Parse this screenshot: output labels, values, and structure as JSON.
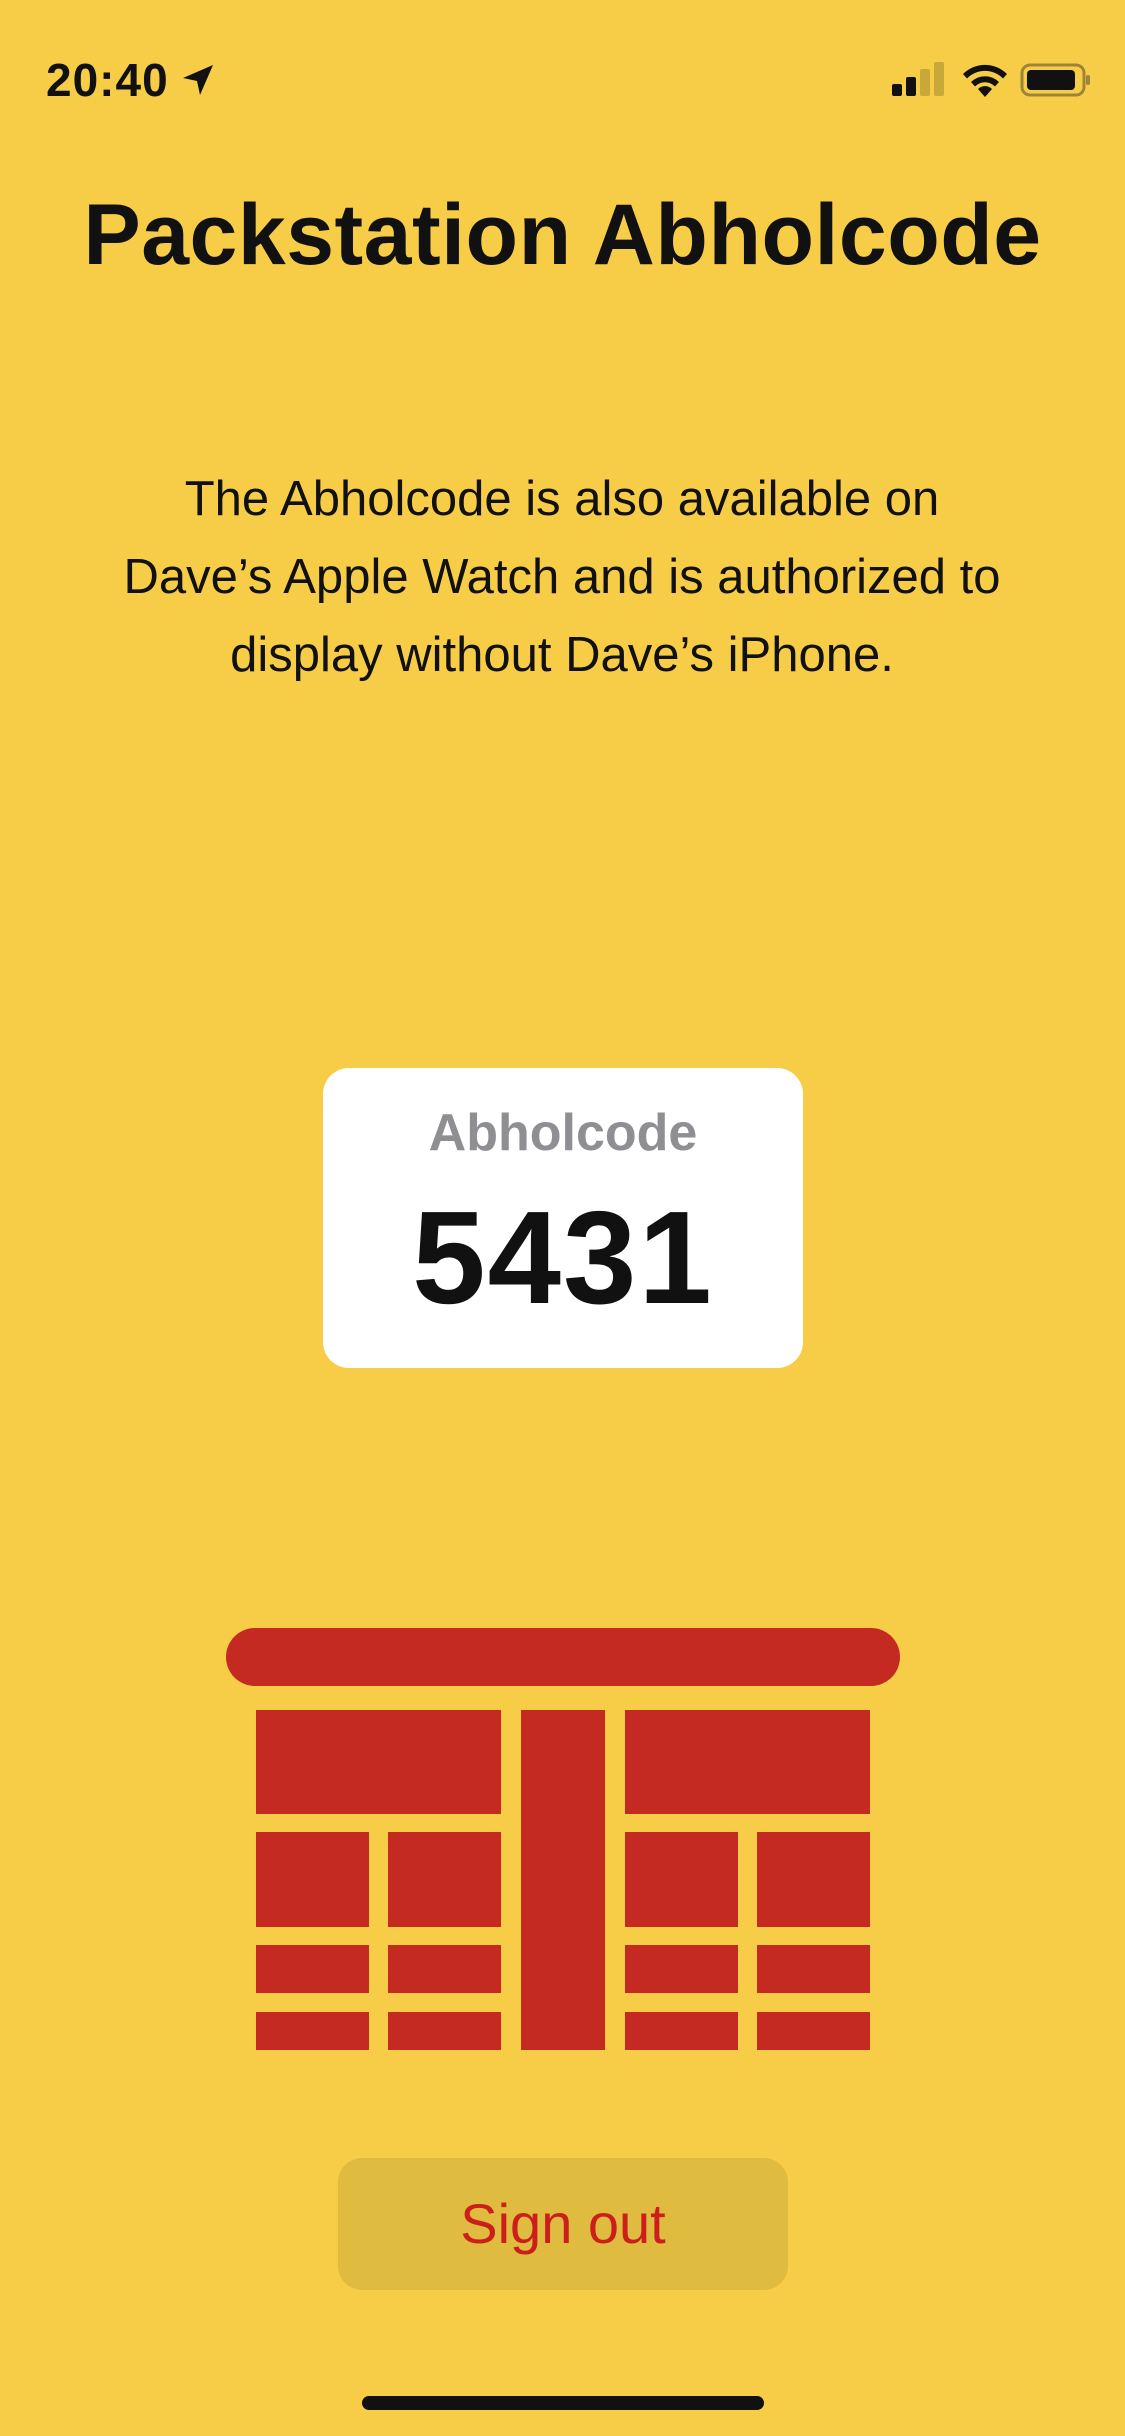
{
  "status_bar": {
    "time": "20:40",
    "icons": [
      "location-arrow-icon",
      "cellular-signal-icon",
      "wifi-icon",
      "battery-icon"
    ]
  },
  "page": {
    "title": "Packstation Abholcode",
    "description": "The Abholcode is also available on Dave’s Apple Watch and is authorized to display without Dave’s iPhone."
  },
  "code_card": {
    "label": "Abholcode",
    "value": "5431"
  },
  "illustration": {
    "icon": "packstation-locker-icon"
  },
  "actions": {
    "sign_out_label": "Sign out"
  },
  "colors": {
    "background": "#F7CD47",
    "card": "#FFFFFF",
    "accent_red": "#C42922",
    "button_bg": "#DFBB3F",
    "button_text": "#CC1F1C",
    "secondary_text": "#8E8E93"
  }
}
